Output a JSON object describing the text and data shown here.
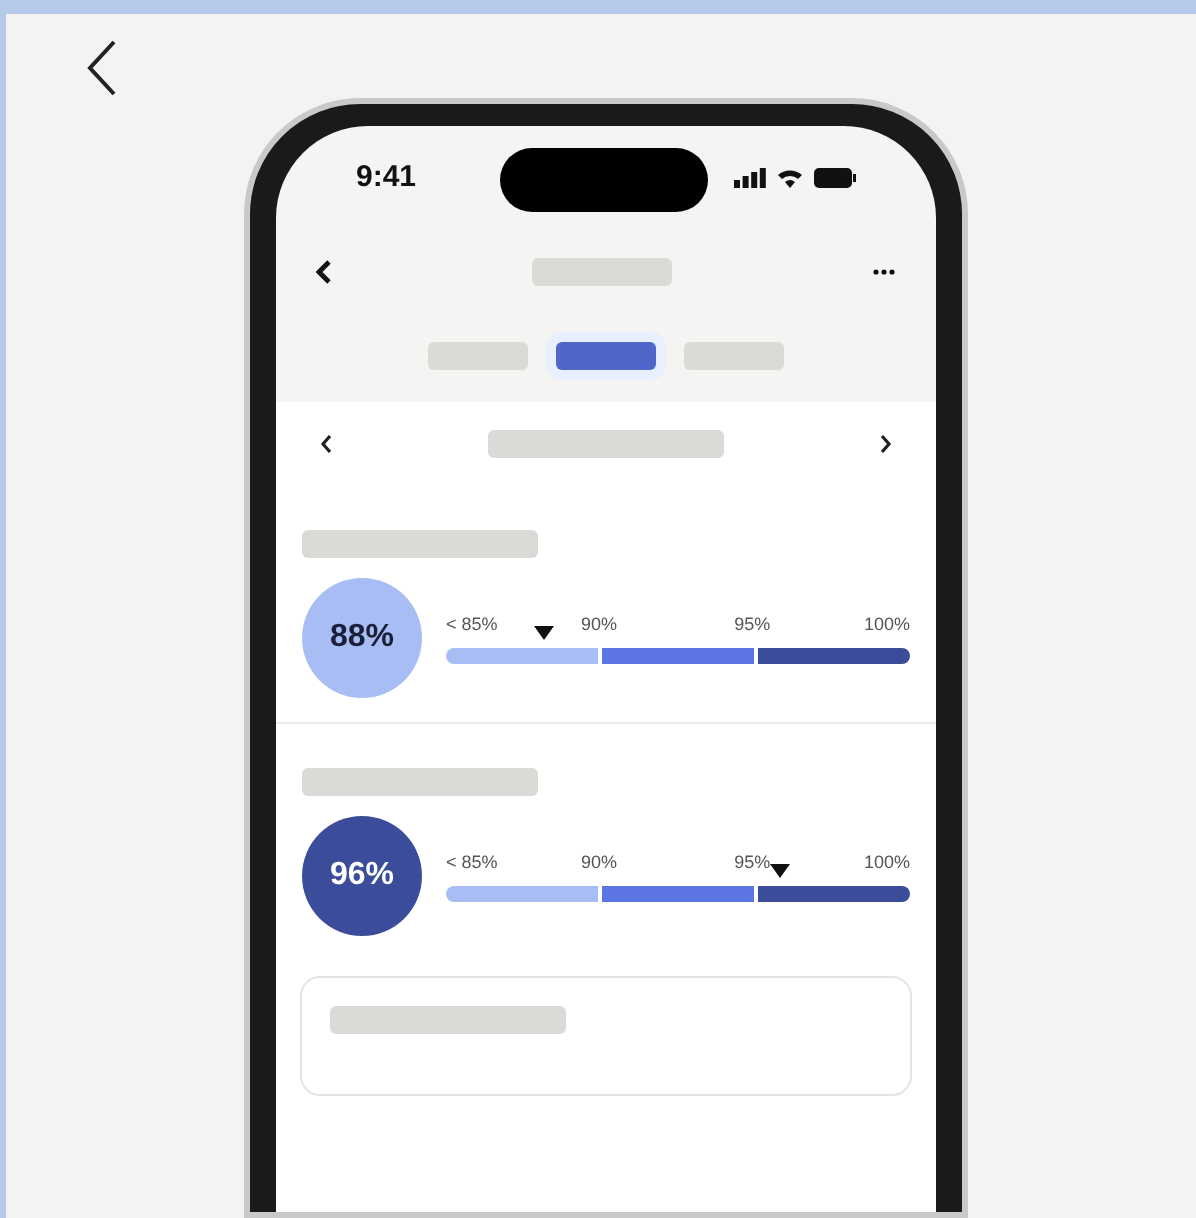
{
  "status_bar": {
    "time": "9:41"
  },
  "tabs": [
    {
      "selected": false
    },
    {
      "selected": true
    },
    {
      "selected": false
    }
  ],
  "metrics": [
    {
      "value": "88%",
      "color": "#a9bdf5",
      "level": 0.21,
      "ticks": [
        "< 85%",
        "90%",
        "95%",
        "100%"
      ]
    },
    {
      "value": "96%",
      "color": "#3b4d9a",
      "level": 0.72,
      "ticks": [
        "< 85%",
        "90%",
        "95%",
        "100%"
      ]
    }
  ]
}
